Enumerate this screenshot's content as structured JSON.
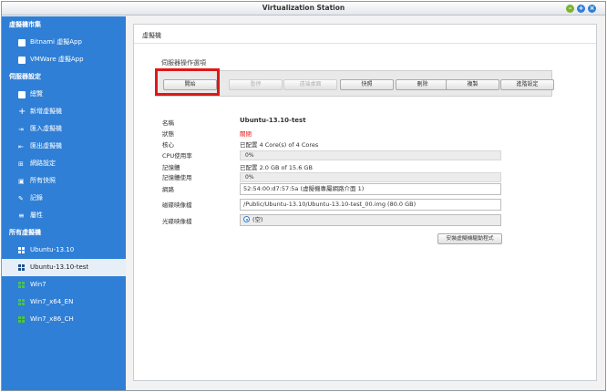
{
  "window": {
    "title": "Virtualization Station"
  },
  "sidebar": {
    "sections": [
      {
        "label": "虛擬機市集",
        "items": [
          {
            "label": "Bitnami 虛擬App"
          },
          {
            "label": "VMWare 虛擬App"
          }
        ]
      },
      {
        "label": "伺服器設定",
        "items": [
          {
            "label": "總覽"
          },
          {
            "label": "新增虛擬機"
          },
          {
            "label": "匯入虛擬機"
          },
          {
            "label": "匯出虛擬機"
          },
          {
            "label": "網路設定"
          },
          {
            "label": "所有快照"
          },
          {
            "label": "記錄"
          },
          {
            "label": "屬性"
          }
        ]
      },
      {
        "label": "所有虛擬機",
        "items": [
          {
            "label": "Ubuntu-13.10"
          },
          {
            "label": "Ubuntu-13.10-test",
            "selected": true
          },
          {
            "label": "Win7"
          },
          {
            "label": "Win7_x64_EN"
          },
          {
            "label": "Win7_x86_CH"
          }
        ]
      }
    ]
  },
  "main": {
    "title": "虛擬機",
    "operations_label": "伺服器操作選項",
    "buttons": [
      {
        "label": "開始",
        "enabled": true
      },
      {
        "label": "暫停",
        "enabled": false
      },
      {
        "label": "遠端桌面",
        "enabled": false
      },
      {
        "label": "快照",
        "enabled": true
      },
      {
        "label": "刪除",
        "enabled": true
      },
      {
        "label": "複製",
        "enabled": true
      },
      {
        "label": "進階設定",
        "enabled": true
      }
    ],
    "details": {
      "name_label": "名稱",
      "name_value": "Ubuntu-13.10-test",
      "status_label": "狀態",
      "status_value": "關閉",
      "core_label": "核心",
      "core_value": "已配置 4 Core(s) of 4 Cores",
      "cpu_label": "CPU使用率",
      "cpu_value": "0%",
      "memory_label": "記憶體",
      "memory_value": "已配置 2.0 GB of 15.6 GB",
      "memory_usage_label": "記憶體使用",
      "memory_usage_value": "0%",
      "network_label": "網路",
      "network_value": "52:54:00:d7:57:5a (虛擬機專屬網路介面 1)",
      "disk_label": "磁碟映像檔",
      "disk_value": "/Public/Ubuntu-13.10/Ubuntu-13.10-test_00.img (80.0 GB)",
      "cdrom_label": "光碟映像檔",
      "cdrom_value": "(空)",
      "eject_button": "安裝虛擬機驅動程式"
    }
  },
  "colors": {
    "sidebar": "#2f7fd6",
    "highlight": "#e01818",
    "status_off": "#e02020"
  }
}
